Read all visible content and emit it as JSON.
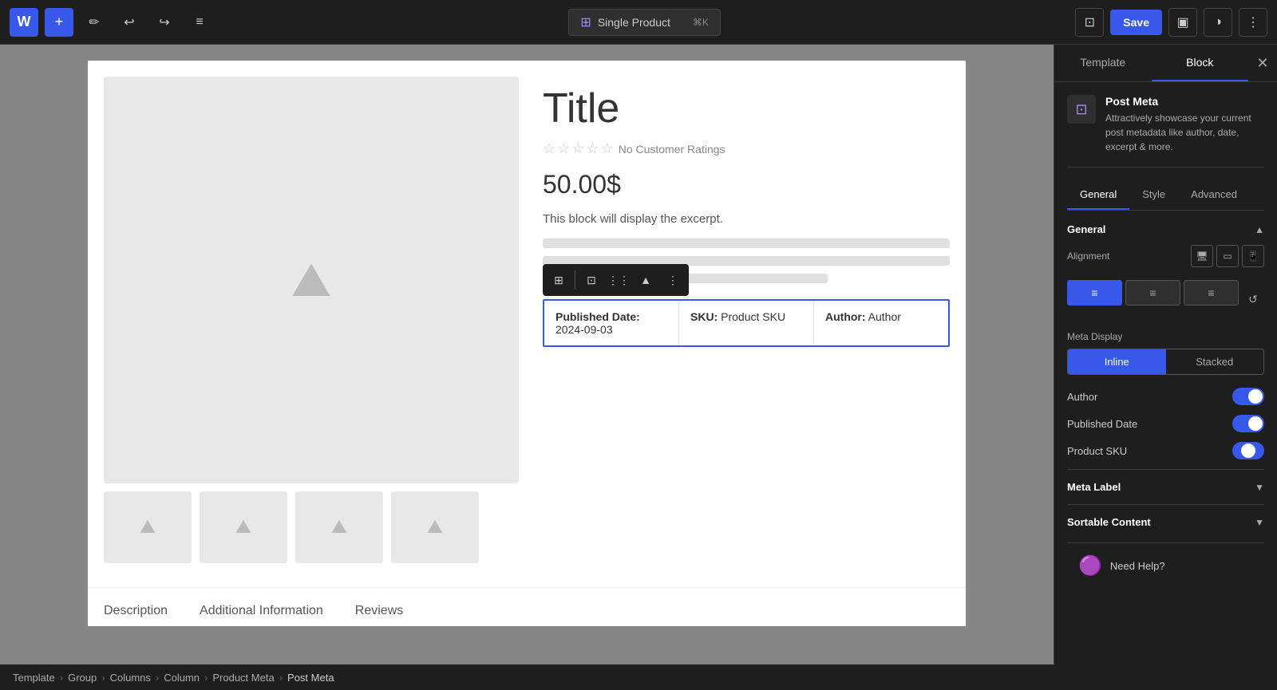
{
  "toolbar": {
    "wp_logo": "W",
    "add_label": "+",
    "edit_label": "✏",
    "undo_label": "↩",
    "redo_label": "↪",
    "list_label": "≡",
    "product_label": "Single Product",
    "shortcut": "⌘K",
    "save_label": "Save",
    "panel_icon": "▣",
    "style_icon": "◑",
    "more_icon": "⋮"
  },
  "canvas": {
    "product_title": "Title",
    "rating_text": "No Customer Ratings",
    "price": "50.00$",
    "excerpt": "This block will display the excerpt.",
    "meta_rows": [
      {
        "label": "Published Date:",
        "value": "2024-09-03"
      },
      {
        "label": "SKU:",
        "value": "Product SKU"
      },
      {
        "label": "Author:",
        "value": "Author"
      }
    ],
    "tabs": [
      "Description",
      "Additional Information",
      "Reviews"
    ]
  },
  "breadcrumb": {
    "items": [
      "Template",
      "Group",
      "Columns",
      "Column",
      "Product Meta",
      "Post Meta"
    ]
  },
  "right_panel": {
    "tab_template": "Template",
    "tab_block": "Block",
    "block_name": "Post Meta",
    "block_desc": "Attractively showcase your current post metadata like author, date, excerpt & more.",
    "sub_tabs": [
      "General",
      "Style",
      "Advanced"
    ],
    "general_section_title": "General",
    "alignment_label": "Alignment",
    "meta_display_label": "Meta Display",
    "display_options": [
      "Inline",
      "Stacked"
    ],
    "toggles": [
      {
        "label": "Author",
        "state": "on"
      },
      {
        "label": "Published Date",
        "state": "on"
      },
      {
        "label": "Product SKU",
        "state": "partial"
      }
    ],
    "meta_label_section": "Meta Label",
    "sortable_section": "Sortable Content",
    "need_help": "Need Help?"
  }
}
